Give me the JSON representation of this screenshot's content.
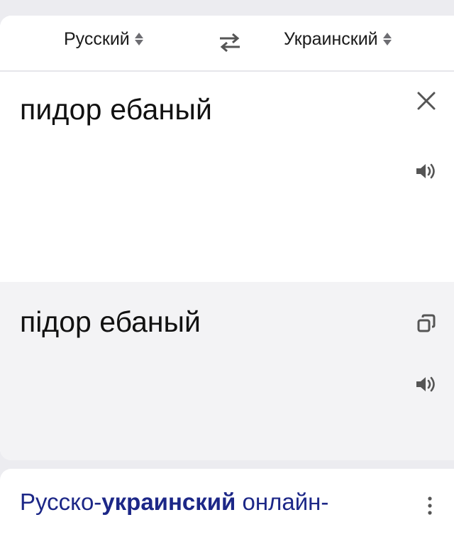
{
  "languages": {
    "source": "Русский",
    "target": "Украинский"
  },
  "source": {
    "text": "пидор ебаный"
  },
  "translation": {
    "text": "підор ебаный"
  },
  "result": {
    "title_part1": "Русско-",
    "title_part2": "украинский",
    "title_part3": " онлайн-"
  },
  "icons": {
    "sort": "updown-arrows-icon",
    "swap": "swap-arrows-icon",
    "clear": "close-icon",
    "speak": "speaker-icon",
    "copy": "copy-icon",
    "more": "more-vertical-icon"
  },
  "colors": {
    "link": "#1c2787",
    "icon": "#555555"
  }
}
